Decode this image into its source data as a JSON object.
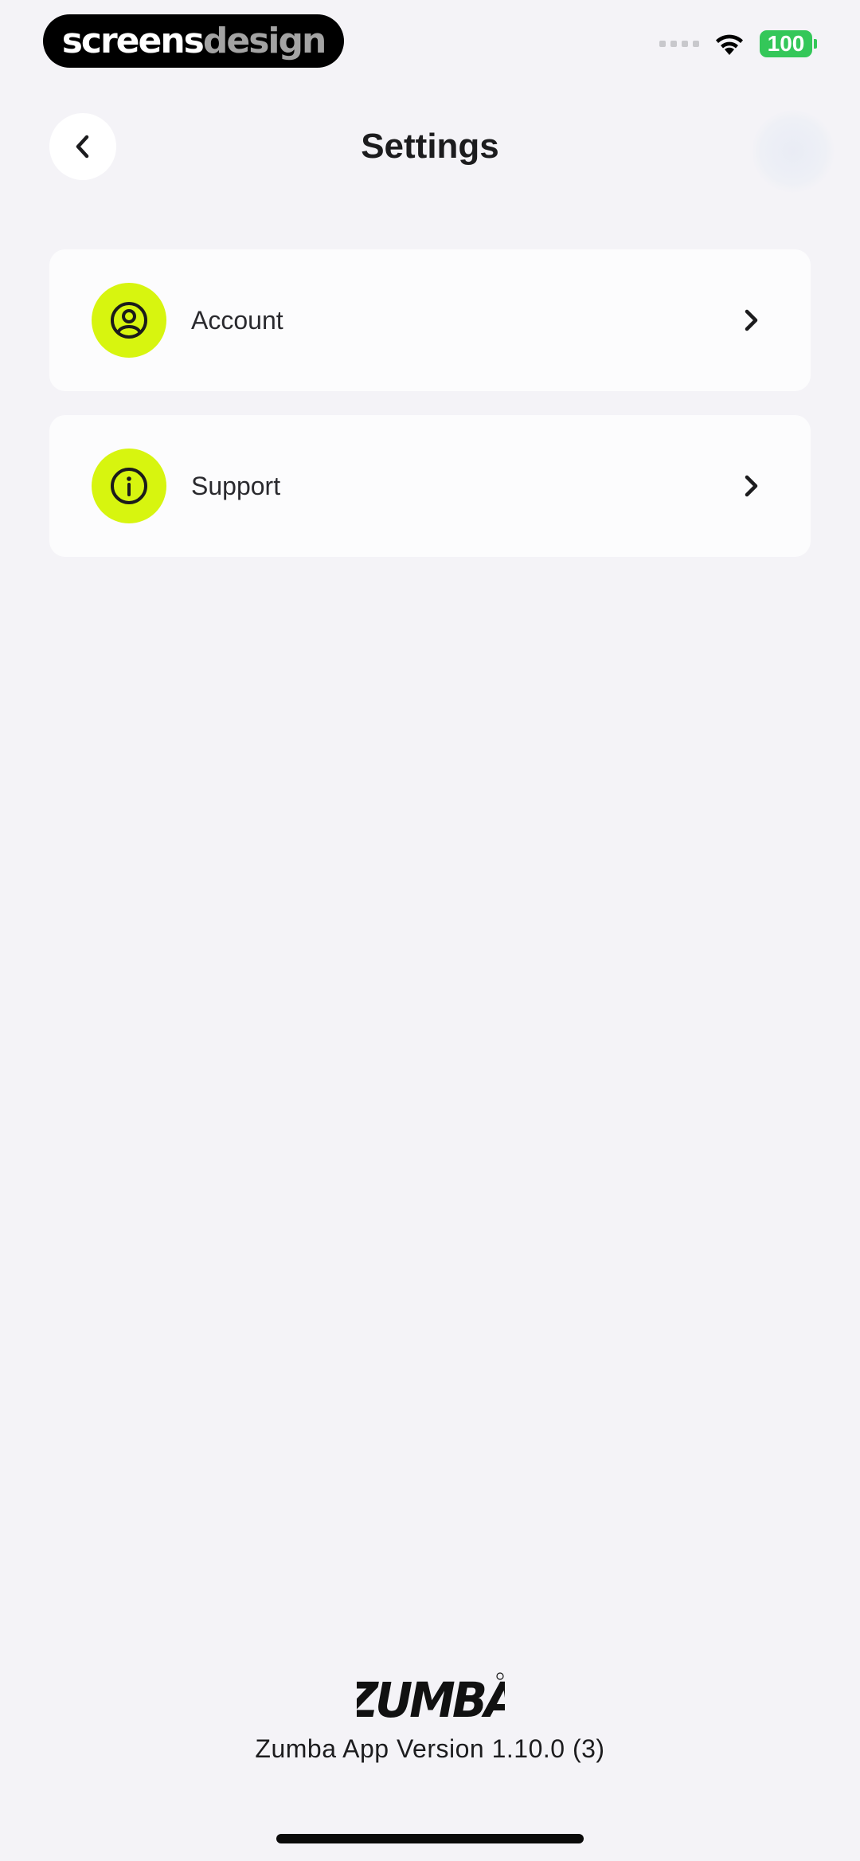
{
  "watermark": {
    "text_part1": "screens",
    "text_part2": "design"
  },
  "status_bar": {
    "battery_level": "100",
    "battery_color": "#34c759",
    "icons": [
      "signal-icon",
      "wifi-icon",
      "battery-icon"
    ]
  },
  "header": {
    "title": "Settings",
    "back_icon": "chevron-left-icon"
  },
  "settings": {
    "items": [
      {
        "label": "Account",
        "icon": "user-circle-icon"
      },
      {
        "label": "Support",
        "icon": "info-icon"
      }
    ],
    "accent_color": "#d7f50f"
  },
  "footer": {
    "logo_text": "ZUMBA",
    "version": "Zumba App Version 1.10.0 (3)"
  }
}
